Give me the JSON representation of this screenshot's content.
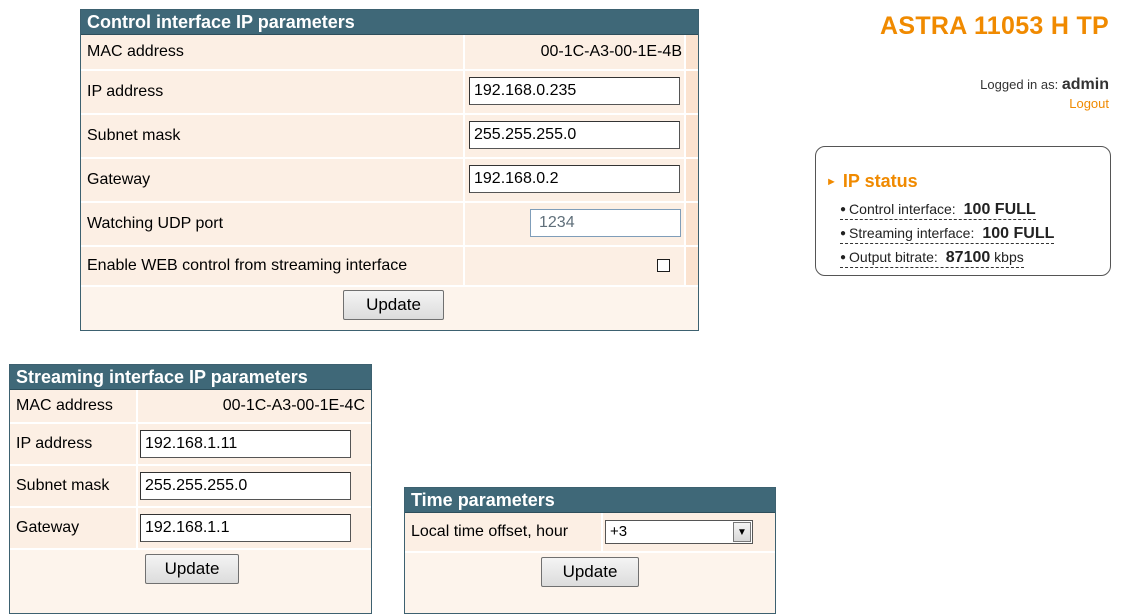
{
  "header": {
    "brand": "ASTRA 11053 H TP",
    "logged_in_label": "Logged in as:",
    "username": "admin",
    "logout": "Logout"
  },
  "ip_status": {
    "title": "IP status",
    "items": [
      {
        "label": "Control interface:",
        "value": "100 FULL",
        "unit": ""
      },
      {
        "label": "Streaming interface:",
        "value": "100 FULL",
        "unit": ""
      },
      {
        "label": "Output bitrate:",
        "value": "87100",
        "unit": "kbps"
      }
    ]
  },
  "control": {
    "title": "Control interface IP parameters",
    "mac_label": "MAC address",
    "mac_value": "00-1C-A3-00-1E-4B",
    "ip_label": "IP address",
    "ip_value": "192.168.0.235",
    "subnet_label": "Subnet mask",
    "subnet_value": "255.255.255.0",
    "gateway_label": "Gateway",
    "gateway_value": "192.168.0.2",
    "udp_label": "Watching UDP port",
    "udp_value": "1234",
    "web_label": "Enable WEB control from streaming interface",
    "web_checked": false,
    "update": "Update"
  },
  "streaming": {
    "title": "Streaming interface IP parameters",
    "mac_label": "MAC address",
    "mac_value": "00-1C-A3-00-1E-4C",
    "ip_label": "IP address",
    "ip_value": "192.168.1.11",
    "subnet_label": "Subnet mask",
    "subnet_value": "255.255.255.0",
    "gateway_label": "Gateway",
    "gateway_value": "192.168.1.1",
    "update": "Update"
  },
  "time": {
    "title": "Time parameters",
    "offset_label": "Local time offset, hour",
    "offset_value": "+3",
    "update": "Update"
  }
}
